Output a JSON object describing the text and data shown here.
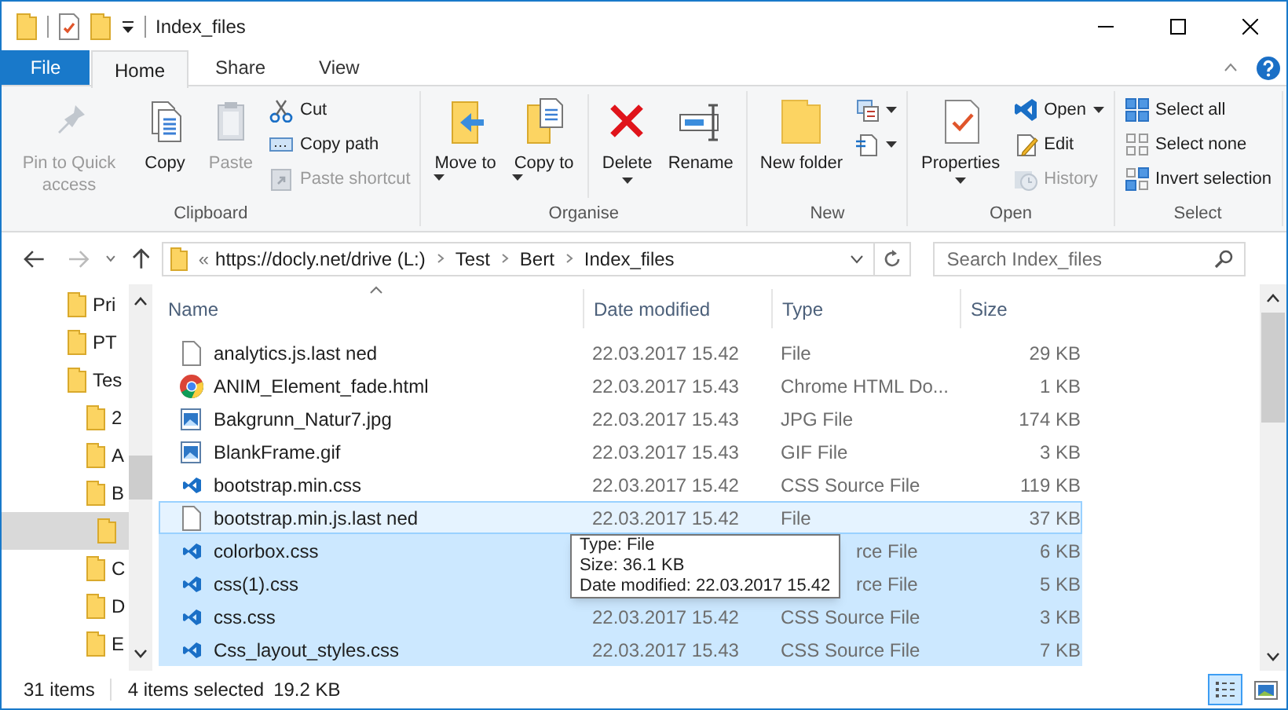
{
  "window": {
    "title": "Index_files"
  },
  "ribbon_tabs": [
    {
      "label": "File",
      "kind": "file",
      "selected": false
    },
    {
      "label": "Home",
      "kind": "tab",
      "selected": true
    },
    {
      "label": "Share",
      "kind": "tab",
      "selected": false
    },
    {
      "label": "View",
      "kind": "tab",
      "selected": false
    }
  ],
  "ribbon_groups": [
    {
      "label": "Clipboard",
      "items": [
        {
          "label": "Pin to Quick access",
          "kind": "large",
          "disabled": true
        },
        {
          "label": "Copy",
          "kind": "large",
          "disabled": false
        },
        {
          "label": "Paste",
          "kind": "large",
          "disabled": true
        },
        {
          "label": "Cut",
          "kind": "small",
          "disabled": false
        },
        {
          "label": "Copy path",
          "kind": "small",
          "disabled": false
        },
        {
          "label": "Paste shortcut",
          "kind": "small",
          "disabled": true
        }
      ]
    },
    {
      "label": "Organise",
      "items": [
        {
          "label": "Move to",
          "kind": "large",
          "disabled": false,
          "dropdown": true
        },
        {
          "label": "Copy to",
          "kind": "large",
          "disabled": false,
          "dropdown": true
        },
        {
          "label": "Delete",
          "kind": "large",
          "disabled": false,
          "dropdown": true
        },
        {
          "label": "Rename",
          "kind": "large",
          "disabled": false
        }
      ]
    },
    {
      "label": "New",
      "items": [
        {
          "label": "New folder",
          "kind": "large",
          "disabled": false
        },
        {
          "kind": "small",
          "disabled": false,
          "dropdown": true
        },
        {
          "kind": "small",
          "disabled": false,
          "dropdown": true
        }
      ]
    },
    {
      "label": "Open",
      "items": [
        {
          "label": "Properties",
          "kind": "large",
          "disabled": false,
          "dropdown": true
        },
        {
          "label": "Open",
          "kind": "small",
          "disabled": false,
          "dropdown": true
        },
        {
          "label": "Edit",
          "kind": "small",
          "disabled": false
        },
        {
          "label": "History",
          "kind": "small",
          "disabled": true
        }
      ]
    },
    {
      "label": "Select",
      "items": [
        {
          "label": "Select all",
          "kind": "small",
          "disabled": false
        },
        {
          "label": "Select none",
          "kind": "small",
          "disabled": false
        },
        {
          "label": "Invert selection",
          "kind": "small",
          "disabled": false
        }
      ]
    }
  ],
  "address": {
    "overflow": "«",
    "crumbs": [
      "https://docly.net/drive (L:)",
      "Test",
      "Bert",
      "Index_files"
    ]
  },
  "search": {
    "placeholder": "Search Index_files"
  },
  "nav": [
    {
      "label": "Pri",
      "selected": false
    },
    {
      "label": "PT",
      "selected": false
    },
    {
      "label": "Tes",
      "selected": false,
      "children": [
        {
          "label": "2",
          "selected": false
        },
        {
          "label": "A",
          "selected": false
        },
        {
          "label": "B",
          "selected": false,
          "children": [
            {
              "selected": true
            }
          ]
        },
        {
          "label": "C",
          "selected": false
        },
        {
          "label": "D",
          "selected": false
        },
        {
          "label": "E",
          "selected": false
        }
      ]
    }
  ],
  "columns": [
    "Name",
    "Date modified",
    "Type",
    "Size"
  ],
  "rows": [
    {
      "name": "analytics.js.last ned",
      "kind": "file",
      "date": "22.03.2017 15.42",
      "type": "File",
      "size": "29 KB",
      "selected": false,
      "hovered": false
    },
    {
      "name": "ANIM_Element_fade.html",
      "kind": "chrome",
      "date": "22.03.2017 15.43",
      "type": "Chrome HTML Do...",
      "size": "1 KB",
      "selected": false,
      "hovered": false
    },
    {
      "name": "Bakgrunn_Natur7.jpg",
      "kind": "image",
      "date": "22.03.2017 15.43",
      "type": "JPG File",
      "size": "174 KB",
      "selected": false,
      "hovered": false
    },
    {
      "name": "BlankFrame.gif",
      "kind": "image",
      "date": "22.03.2017 15.43",
      "type": "GIF File",
      "size": "3 KB",
      "selected": false,
      "hovered": false
    },
    {
      "name": "bootstrap.min.css",
      "kind": "css",
      "date": "22.03.2017 15.42",
      "type": "CSS Source File",
      "size": "119 KB",
      "selected": false,
      "hovered": false
    },
    {
      "name": "bootstrap.min.js.last ned",
      "kind": "file",
      "date": "22.03.2017 15.42",
      "type": "File",
      "size": "37 KB",
      "selected": false,
      "hovered": true
    },
    {
      "name": "colorbox.css",
      "kind": "css",
      "covered": true,
      "type": "rce File",
      "size": "6 KB",
      "selected": true,
      "hovered": false
    },
    {
      "name": "css(1).css",
      "kind": "css",
      "covered": true,
      "type": "rce File",
      "size": "5 KB",
      "selected": true,
      "hovered": false
    },
    {
      "name": "css.css",
      "kind": "css",
      "date": "22.03.2017 15.42",
      "type": "CSS Source File",
      "size": "3 KB",
      "selected": true,
      "hovered": false
    },
    {
      "name": "Css_layout_styles.css",
      "kind": "css",
      "date": "22.03.2017 15.43",
      "type": "CSS Source File",
      "size": "7 KB",
      "selected": true,
      "hovered": false
    }
  ],
  "tooltip": [
    "Type: File",
    "Size: 36.1 KB",
    "Date modified: 22.03.2017 15.42"
  ],
  "status_bar": {
    "count": "31 items",
    "selection": "4 items selected",
    "size": "19.2 KB"
  },
  "views": [
    {
      "selected": true
    },
    {
      "selected": false
    }
  ]
}
